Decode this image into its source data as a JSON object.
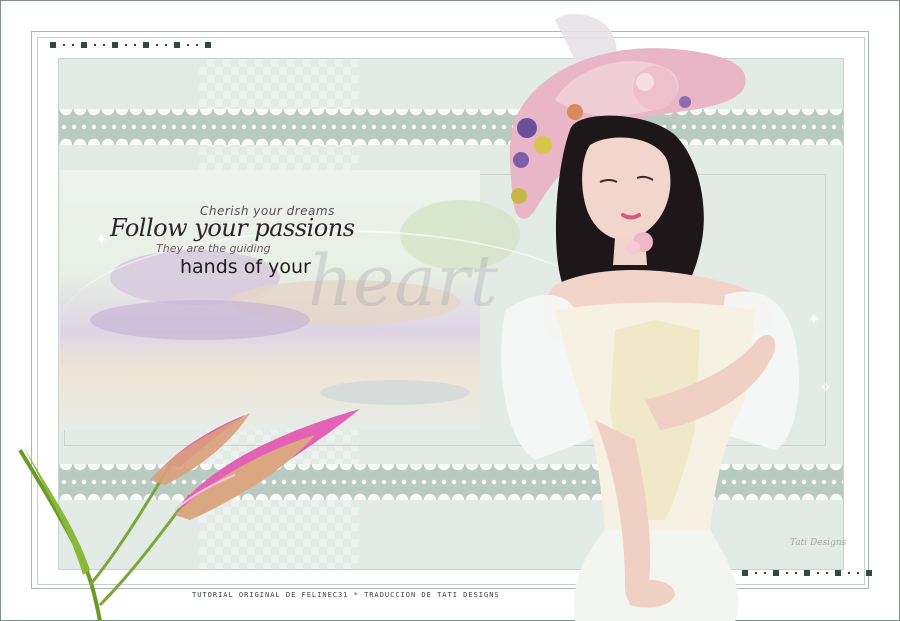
{
  "artwork": {
    "quote": {
      "line1": "Cherish your dreams",
      "line2": "Follow your passions",
      "line3": "They are the guiding",
      "line4": "hands of your",
      "line5": "heart"
    },
    "credit": "TUTORIAL ORIGINAL DE FELINEC31 * TRADUCCION DE TATI DESIGNS",
    "signature": "Tati Designs"
  },
  "colors": {
    "frame": "#7e9088",
    "panel": "#e3ebe7",
    "lace": "#b9cac2",
    "accent": "#2f4a44"
  }
}
